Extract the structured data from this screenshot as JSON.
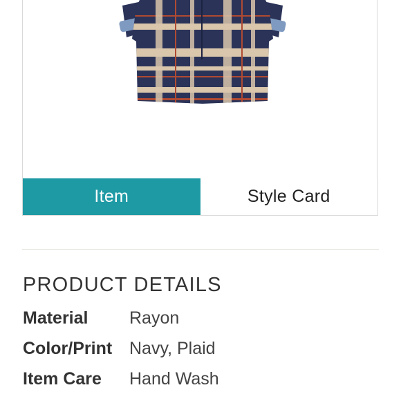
{
  "product": {
    "image_alt": "navy plaid rayon shirt",
    "colors": {
      "navy": "#2b3358",
      "tan": "#d9c6ab",
      "red": "#b04a32",
      "cuff_blue": "#7f9ac0"
    }
  },
  "tabs": [
    {
      "label": "Item",
      "active": true
    },
    {
      "label": "Style Card",
      "active": false
    }
  ],
  "details": {
    "title": "PRODUCT DETAILS",
    "rows": [
      {
        "label": "Material",
        "value": "Rayon"
      },
      {
        "label": "Color/Print",
        "value": "Navy, Plaid"
      },
      {
        "label": "Item Care",
        "value": "Hand Wash"
      }
    ]
  },
  "colors": {
    "accent": "#1e9aa5",
    "text": "#333333",
    "border": "#d9d9d9"
  }
}
